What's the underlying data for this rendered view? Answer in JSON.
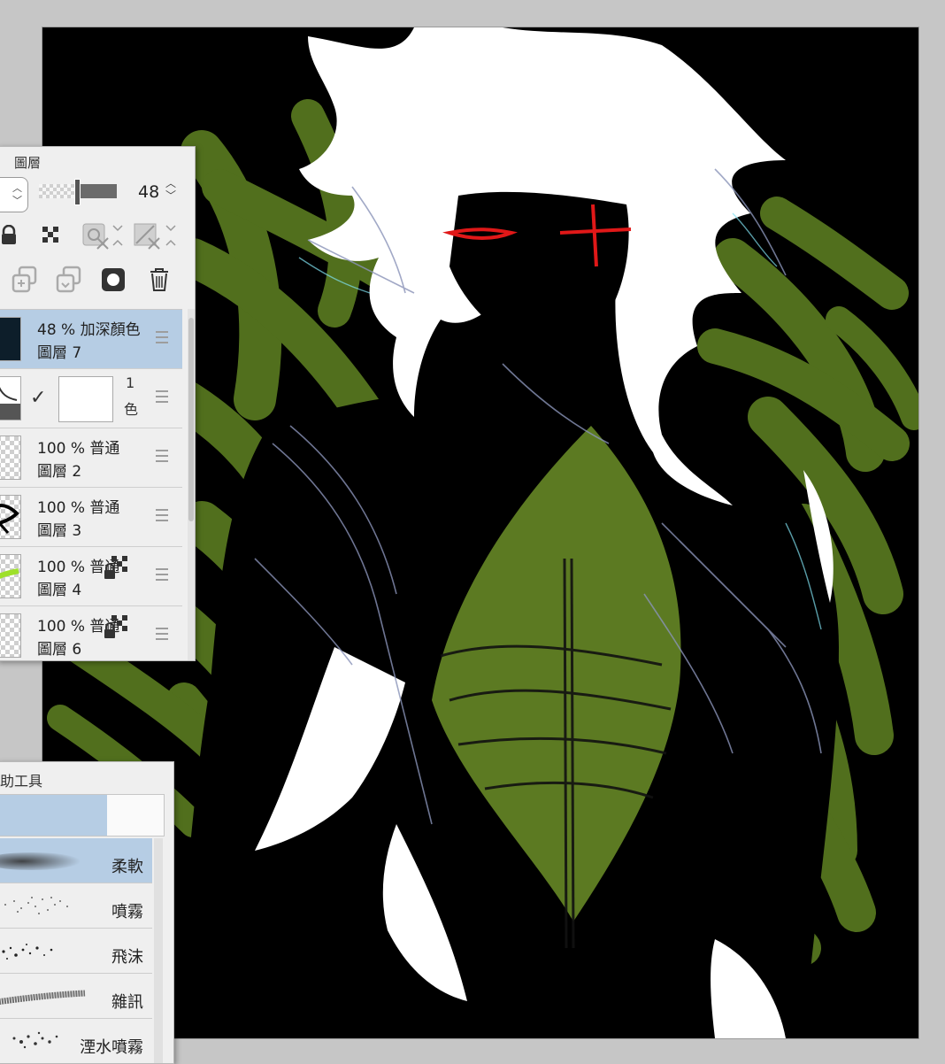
{
  "layer_panel": {
    "title": "圖層",
    "opacity_value": "48",
    "opacity_fraction": 0.48,
    "icons": [
      "lock-icon",
      "lock-transparency-icon",
      "clip-layer-icon",
      "reference-layer-icon",
      "copy-layer-icon",
      "merge-layer-icon",
      "mask-icon",
      "trash-icon"
    ],
    "layers": [
      {
        "line1": "48 %  加深顏色",
        "line2": "圖層 7",
        "selected": true,
        "thumb": "dark",
        "lock": false
      },
      {
        "line1": "1",
        "line2": "色",
        "selected": false,
        "thumb": "adjust",
        "lock": false,
        "checked": true
      },
      {
        "line1": "100 %  普通",
        "line2": "圖層 2",
        "selected": false,
        "thumb": "transparent",
        "lock": false
      },
      {
        "line1": "100 %  普通",
        "line2": "圖層 3",
        "selected": false,
        "thumb": "sketch",
        "lock": false
      },
      {
        "line1": "100 %  普通",
        "line2": "圖層 4",
        "selected": false,
        "thumb": "green",
        "lock": true
      },
      {
        "line1": "100 %  普通",
        "line2": "圖層 6",
        "selected": false,
        "thumb": "transparent",
        "lock": true
      }
    ]
  },
  "brush_panel": {
    "title": "助工具",
    "brushes": [
      {
        "label": "柔軟",
        "selected": true
      },
      {
        "label": "噴霧",
        "selected": false
      },
      {
        "label": "飛沫",
        "selected": false
      },
      {
        "label": "雜訊",
        "selected": false
      },
      {
        "label": "湮水噴霧",
        "selected": false
      }
    ]
  },
  "colors": {
    "canvas_bg": "#000000",
    "hair": "#ffffff",
    "green": "#5c7a22",
    "eyes": "#e01818",
    "selection": "#b6cde4"
  }
}
